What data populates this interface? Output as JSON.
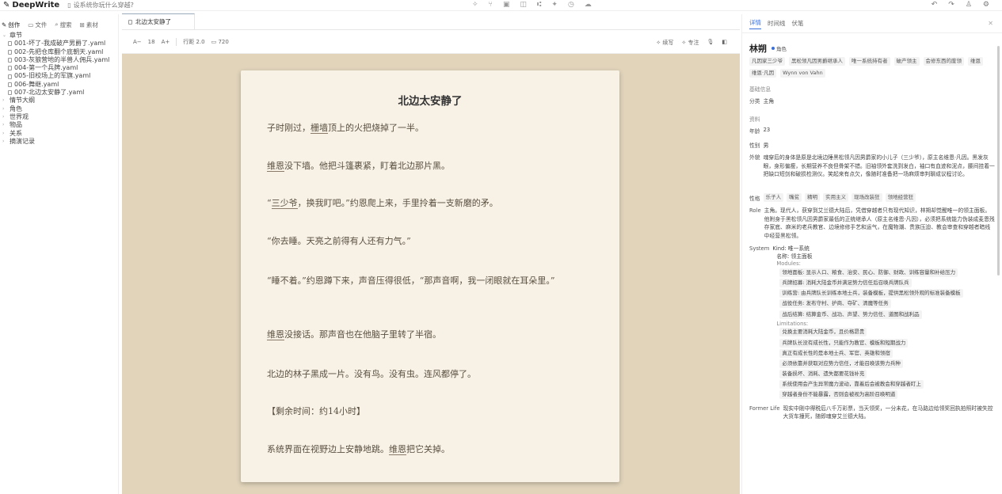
{
  "app": {
    "title": "DeepWrite",
    "subtitle": "设系统你玩什么穿越?"
  },
  "left": {
    "tabs": [
      "创作",
      "文件",
      "搜索",
      "素材"
    ],
    "tree": {
      "chapters": "章节",
      "files": [
        "001-坏了-我成破产男爵了.yaml",
        "002-先把仓库翻个底朝天.yaml",
        "003-灰狼营地的半兽人佣兵.yaml",
        "004-第一个兵牌.yaml",
        "005-旧校场上的军旗.yaml",
        "006-舞继.yaml",
        "007-北边太安静了.yaml"
      ],
      "sections": [
        "情节大纲",
        "角色",
        "世界观",
        "物品",
        "关系",
        "摘演记录"
      ]
    }
  },
  "editor": {
    "tab_label": "北边太安静了",
    "toolbar": {
      "font_dec": "A−",
      "font_size": "18",
      "font_inc": "A+",
      "line_height": "行距 2.0",
      "width": "720",
      "write": "续写",
      "focus": "专注"
    },
    "title": "北边太安静了",
    "paragraphs": [
      {
        "parts": [
          {
            "t": "子时刚过，"
          },
          {
            "t": "栅墙",
            "link": true
          },
          {
            "t": "顶上的火把烧掉了一半。"
          }
        ]
      },
      {
        "parts": [
          {
            "t": "维恩",
            "link": true
          },
          {
            "t": "没下墙。他把斗篷裹紧，盯着北边那片黑。"
          }
        ]
      },
      {
        "parts": [
          {
            "t": "“"
          },
          {
            "t": "三少爷",
            "link": true
          },
          {
            "t": "，换我盯吧。”约恩爬上来，手里拎着一支新磨的矛。"
          }
        ]
      },
      {
        "parts": [
          {
            "t": "“你去睡。天亮之前得有人还有力气。”"
          }
        ]
      },
      {
        "parts": [
          {
            "t": "“睡不着。”约恩蹲下来，声音压得很低，“那声音啊，我一闭眼就在耳朵里。”"
          }
        ]
      },
      {
        "parts": [
          {
            "t": "维恩",
            "link": true
          },
          {
            "t": "没接话。那声音也在他脑子里转了半宿。"
          }
        ]
      },
      {
        "parts": [
          {
            "t": "北边的林子黑成一片。没有鸟。没有虫。连风都停了。"
          }
        ]
      },
      {
        "parts": [
          {
            "t": "【剩余时间：约14小时】"
          }
        ]
      },
      {
        "parts": [
          {
            "t": "系统界面在视野边上安静地跳。"
          },
          {
            "t": "维恩",
            "link": true
          },
          {
            "t": "把它关掉。"
          }
        ]
      }
    ]
  },
  "panel": {
    "tabs": [
      "详情",
      "时间线",
      "伏笔"
    ],
    "name": "林朔",
    "role_badge": "角色",
    "aliases": [
      "凡因家三少爷",
      "黑松领凡因男爵继承人",
      "唯一系统持有者",
      "破产领主",
      "会修东西的废领",
      "维恩",
      "维恩·凡因",
      "Wynn von Vahn"
    ],
    "basic_label": "基础信息",
    "category_key": "分类",
    "category_val": "主角",
    "profile_label": "资料",
    "age_key": "年龄",
    "age_val": "23",
    "gender_key": "性别",
    "gender_val": "男",
    "looks_key": "外貌",
    "looks_val": "魂穿后的身体是原是北境边陲黑松领凡因男爵家的小儿子（三少爷），原主名维恩·凡因。黑发灰眼，身形偏瘦，长期营养不良但骨架不错。旧袖领外套洗到发白，袖口有血迹和泥点，腰间挂着一把缺口短剑和破损检测仪。笑起来有点欠，像随时准备把一场麻烦审判聊成议程讨论。",
    "traits_key": "性格",
    "traits": [
      "乐子人",
      "嘴贫",
      "精明",
      "实用主义",
      "现场改装狂",
      "领地经营狂"
    ],
    "role_key": "Role",
    "role_val": "主角。现代人，获穿到艾兰德大陆后，凭借穿越者只有现代知识，林朔却觉醒唯一的领主面板。他附身于黑松领凡因男爵家最低的正统继承人（原主名维恩·凡因），必须把系统能力伪装成麦恩残存家底、麻米的老兵教官、边境修修手艺和运气，在魔物潮、贵族压迫、教会审查和穿越者暗线中经营黑松领。",
    "system_key": "System",
    "system_kind": "Kind: 唯一系统",
    "system_name": "名称: 领主面板",
    "modules_label": "Modules:",
    "modules": [
      "领地面板: 显示人口、粮食、治安、民心、防御、财政、训练容量和补给压力",
      "兵牌招募: 消耗大陆金币并满足势力信任后召唤兵牌队兵",
      "训练营: 由兵牌队长训练本地士兵，装备模板，提供黑松领外观的标准装备模板",
      "战役任务: 发布守村、护商、夺矿、清魔等任务",
      "战后结算: 结算金币、战功、声望、势力信任、道图和战利品"
    ],
    "limits_label": "Limitations:",
    "limits": [
      "兑换主要消耗大陆金币，且价格昂贵",
      "兵牌队长没有成长性，只能作为教官、模板和短期战力",
      "真正有成长性的是本地士兵、军官、英雄和领宿",
      "必须依靠并获取对应势力信任，才能召唤该势力兵种",
      "装备损坏、消耗、遗失都要花钱补充",
      "系统使用会产生异常魔力波动，靠着后会被教会和穿越者盯上",
      "穿越者身份不能暴露，否则会被视为高阶召唤明道"
    ],
    "former_key": "Former Life",
    "former_val": "现实中刚中得税后八千万彩票，当天领奖，一分未花，在马路边给领奖回执拍照时被失控大货车撞死，随即魂穿艾兰德大陆。"
  }
}
